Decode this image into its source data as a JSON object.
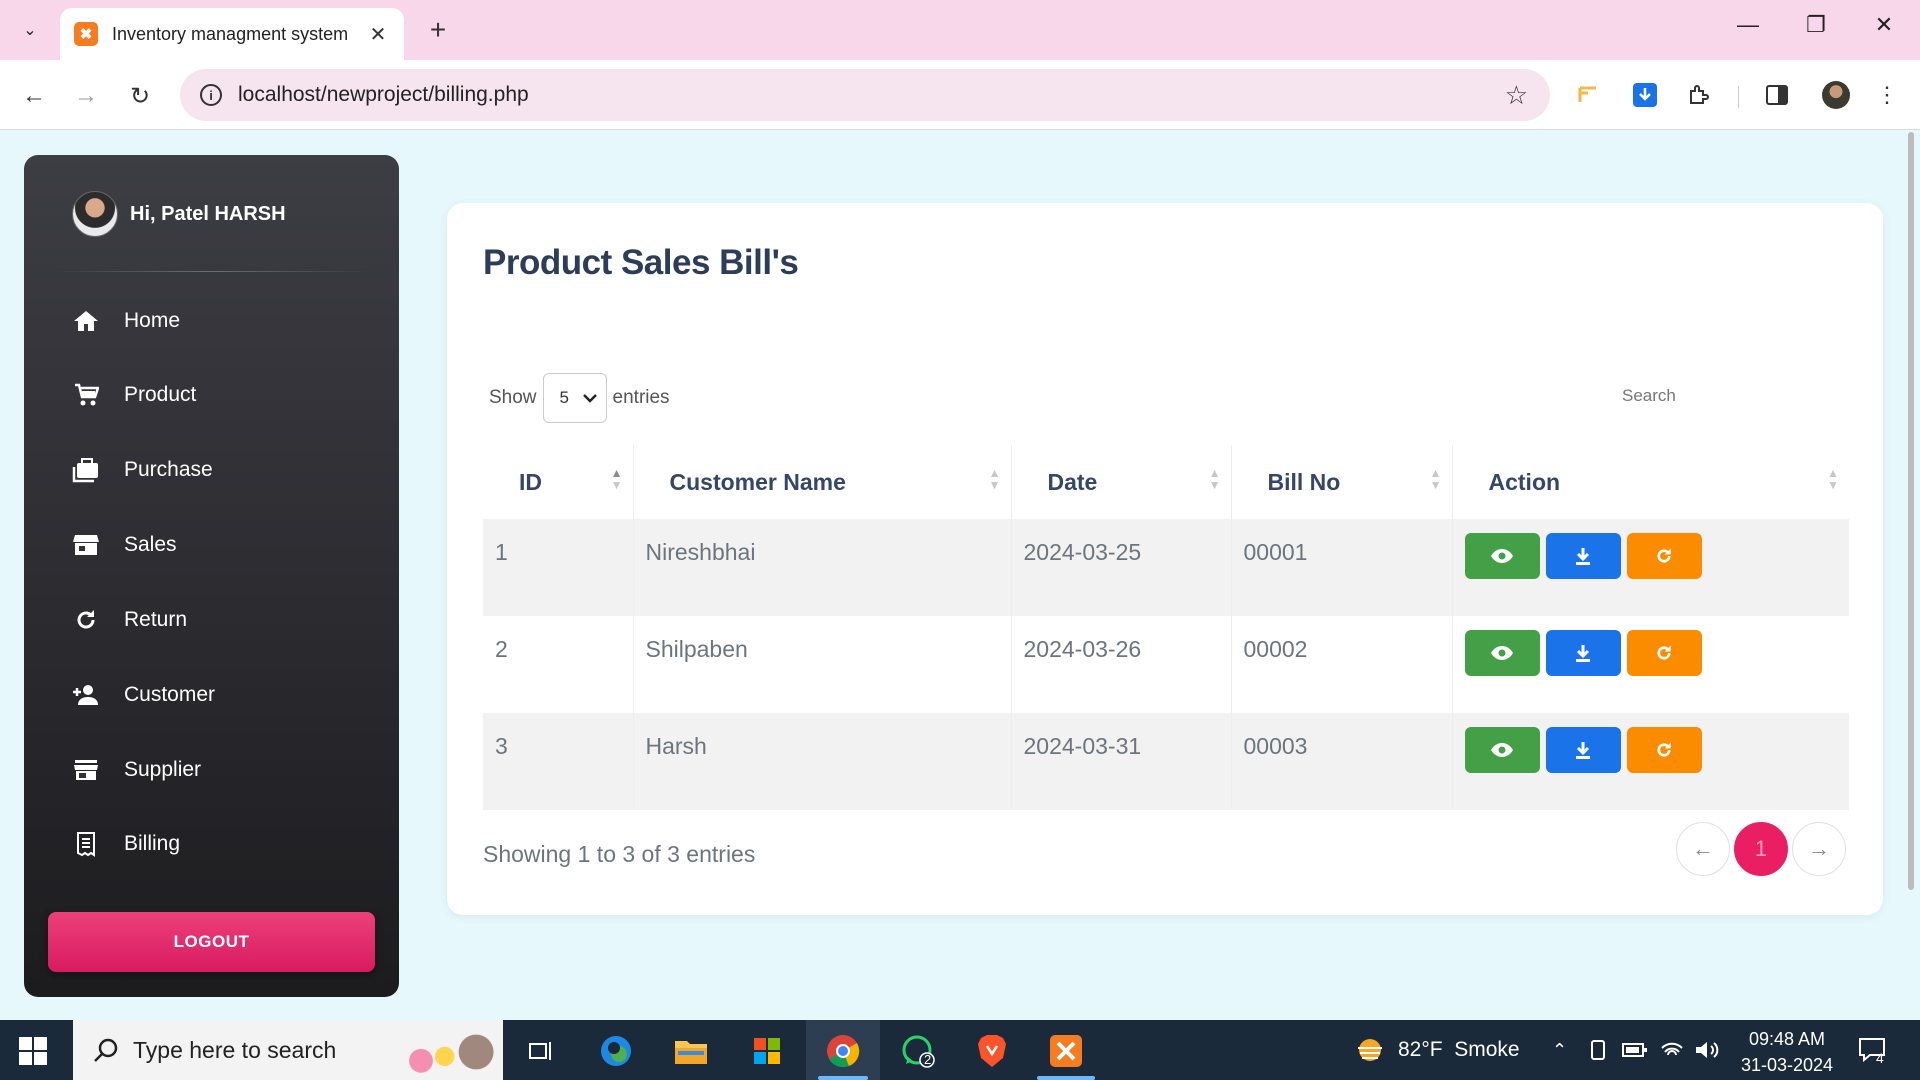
{
  "browser": {
    "tab_title": "Inventory managment system",
    "url": "localhost/newproject/billing.php"
  },
  "sidebar": {
    "greeting": "Hi, Patel HARSH",
    "items": [
      {
        "label": "Home",
        "icon": "home-icon"
      },
      {
        "label": "Product",
        "icon": "cart-icon"
      },
      {
        "label": "Purchase",
        "icon": "briefcase-icon"
      },
      {
        "label": "Sales",
        "icon": "store-icon"
      },
      {
        "label": "Return",
        "icon": "refresh-icon"
      },
      {
        "label": "Customer",
        "icon": "person-add-icon"
      },
      {
        "label": "Supplier",
        "icon": "storefront-icon"
      },
      {
        "label": "Billing",
        "icon": "receipt-icon"
      }
    ],
    "logout_label": "LOGOUT",
    "accent": "#e91e63"
  },
  "main": {
    "title": "Product Sales Bill's",
    "show_label": "Show",
    "entries_value": "5",
    "entries_label": "entries",
    "search_placeholder": "Search",
    "columns": [
      "ID",
      "Customer Name",
      "Date",
      "Bill No",
      "Action"
    ],
    "rows": [
      {
        "id": "1",
        "customer": "Nireshbhai",
        "date": "2024-03-25",
        "bill_no": "00001"
      },
      {
        "id": "2",
        "customer": "Shilpaben",
        "date": "2024-03-26",
        "bill_no": "00002"
      },
      {
        "id": "3",
        "customer": "Harsh",
        "date": "2024-03-31",
        "bill_no": "00003"
      }
    ],
    "info": "Showing 1 to 3 of 3 entries",
    "pagination": {
      "prev": "←",
      "current": "1",
      "next": "→"
    },
    "action_colors": {
      "view": "#43a047",
      "download": "#1a73e8",
      "return": "#fb8c00"
    }
  },
  "taskbar": {
    "search_placeholder": "Type here to search",
    "whatsapp_badge": "2",
    "weather": "82°F  Smoke",
    "time": "09:48 AM",
    "date": "31-03-2024",
    "notification_count": "4"
  }
}
